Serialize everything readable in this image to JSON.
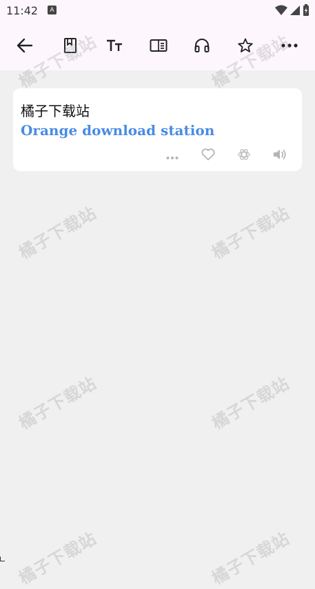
{
  "status": {
    "time": "11:42",
    "notification_glyph": "A",
    "icons": [
      "wifi-icon",
      "cell-signal-icon",
      "battery-charging-icon"
    ]
  },
  "toolbar": {
    "buttons": [
      {
        "name": "back-button",
        "icon": "arrow-left-icon"
      },
      {
        "name": "notebook-button",
        "icon": "bookmark-book-icon"
      },
      {
        "name": "font-size-button",
        "icon": "text-size-icon"
      },
      {
        "name": "reader-button",
        "icon": "book-reader-icon"
      },
      {
        "name": "listen-button",
        "icon": "headphones-icon"
      },
      {
        "name": "favorite-button",
        "icon": "star-icon"
      },
      {
        "name": "more-button",
        "icon": "more-horizontal-icon"
      }
    ]
  },
  "card": {
    "source_text": "橘子下载站",
    "translation_text": "Orange download station",
    "actions": [
      "more-dots-icon",
      "heart-icon",
      "ai-assistant-icon",
      "speaker-icon"
    ]
  },
  "watermark_text": "橘子下载站",
  "colors": {
    "background": "#f0f0f0",
    "toolbar_bg": "#fdf7fd",
    "card_bg": "#ffffff",
    "translation": "#4a8be3"
  }
}
